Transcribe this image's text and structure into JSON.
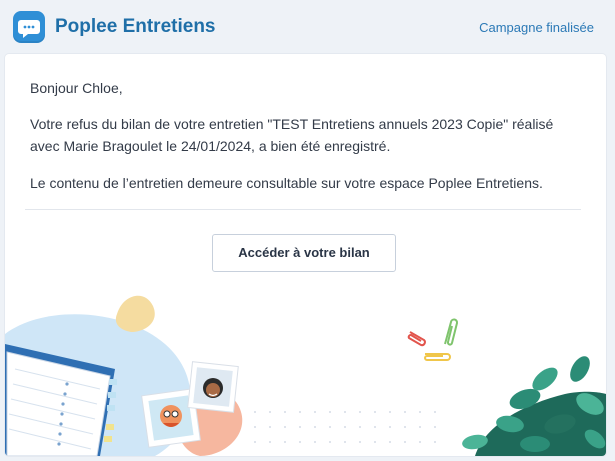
{
  "header": {
    "app_title": "Poplee Entretiens",
    "status": "Campagne finalisée"
  },
  "message": {
    "greeting": "Bonjour Chloe,",
    "line1": "Votre refus du bilan de votre entretien \"TEST Entretiens annuels 2023 Copie\" réalisé",
    "line2": "avec Marie Bragoulet le 24/01/2024, a bien été enregistré.",
    "line3": "Le contenu de l’entretien demeure consultable sur votre espace Poplee Entretiens."
  },
  "cta": {
    "label": "Accéder à votre bilan"
  },
  "colors": {
    "brand_blue": "#1f6fa8",
    "page_bg": "#eef2f7",
    "card_bg": "#ffffff"
  },
  "icons": {
    "logo": "chat-bubble-icon",
    "illustration": "decorative-illustration"
  }
}
